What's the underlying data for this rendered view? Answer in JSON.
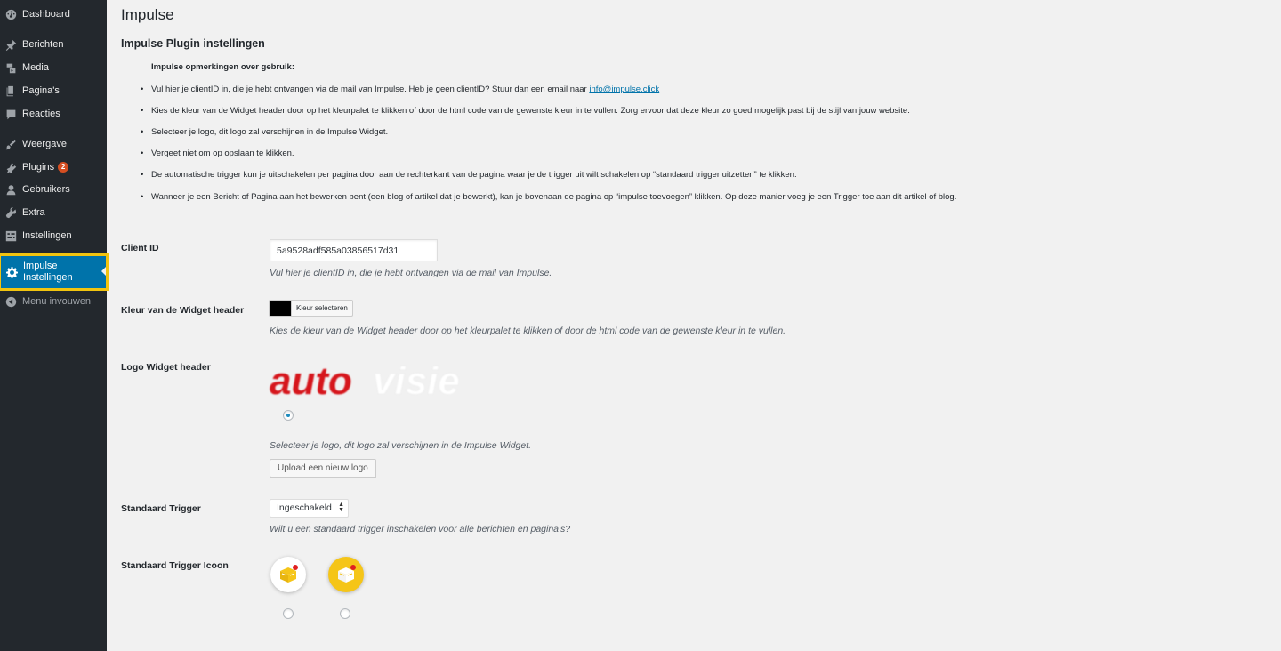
{
  "sidebar": {
    "items": [
      {
        "label": "Dashboard",
        "icon": "dashboard-icon"
      },
      {
        "label": "Berichten",
        "icon": "pin-icon"
      },
      {
        "label": "Media",
        "icon": "media-icon"
      },
      {
        "label": "Pagina's",
        "icon": "pages-icon"
      },
      {
        "label": "Reacties",
        "icon": "comments-icon"
      },
      {
        "label": "Weergave",
        "icon": "appearance-icon"
      },
      {
        "label": "Plugins",
        "icon": "plugins-icon",
        "badge": "2"
      },
      {
        "label": "Gebruikers",
        "icon": "users-icon"
      },
      {
        "label": "Extra",
        "icon": "tools-icon"
      },
      {
        "label": "Instellingen",
        "icon": "settings-icon"
      },
      {
        "label": "Impulse Instellingen",
        "icon": "gear-icon",
        "active": true
      },
      {
        "label": "Menu invouwen",
        "icon": "collapse-icon"
      }
    ],
    "active_color": "#0073aa",
    "highlight_color": "#f1c40f"
  },
  "page": {
    "title": "Impulse",
    "section_title": "Impulse Plugin instellingen",
    "notes_heading": "Impulse opmerkingen over gebruik:",
    "notes": [
      {
        "text": "Vul hier je clientID in, die je hebt ontvangen via de mail van Impulse. Heb je geen clientID? Stuur dan een email naar ",
        "link": "info@impulse.click"
      },
      {
        "text": "Kies de kleur van de Widget header door op het kleurpalet te klikken of door de html code van de gewenste kleur in te vullen. Zorg ervoor dat deze kleur zo goed mogelijk past bij de stijl van jouw website."
      },
      {
        "text": "Selecteer je logo, dit logo zal verschijnen in de Impulse Widget."
      },
      {
        "text": "Vergeet niet om op opslaan te klikken."
      },
      {
        "text": "De automatische trigger kun je uitschakelen per pagina door aan de rechterkant van de pagina waar je de trigger uit wilt schakelen op “standaard trigger uitzetten” te klikken."
      },
      {
        "text": "Wanneer je een Bericht of Pagina aan het bewerken bent (een blog of artikel dat je bewerkt), kan je bovenaan de pagina op “impulse toevoegen” klikken. Op deze manier voeg je een Trigger toe aan dit artikel of blog."
      }
    ]
  },
  "form": {
    "client_id": {
      "label": "Client ID",
      "value": "5a9528adf585a03856517d31",
      "description": "Vul hier je clientID in, die je hebt ontvangen via de mail van Impulse."
    },
    "widget_color": {
      "label": "Kleur van de Widget header",
      "button": "Kleur selecteren",
      "color": "#000000",
      "description": "Kies de kleur van de Widget header door op het kleurpalet te klikken of door de html code van de gewenste kleur in te vullen."
    },
    "logo": {
      "label": "Logo Widget header",
      "logo_text_1": "auto",
      "logo_text_2": "visie",
      "description": "Selecteer je logo, dit logo zal verschijnen in de Impulse Widget.",
      "upload_button": "Upload een nieuw logo"
    },
    "default_trigger": {
      "label": "Standaard Trigger",
      "selected": "Ingeschakeld",
      "description": "Wilt u een standaard trigger inschakelen voor alle berichten en pagina's?"
    },
    "trigger_icon": {
      "label": "Standaard Trigger Icoon",
      "options": [
        {
          "icon": "box-icon-white",
          "background": "#ffffff"
        },
        {
          "icon": "box-icon-yellow",
          "background": "#f5c518"
        }
      ]
    }
  }
}
